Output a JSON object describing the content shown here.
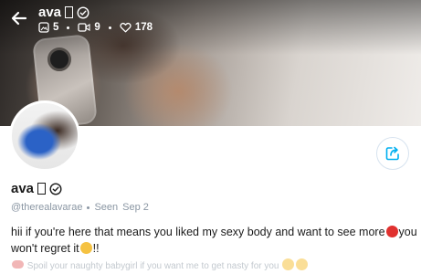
{
  "profile": {
    "display_name": "ava",
    "handle": "@therealavarae",
    "seen_label": "Seen",
    "seen_date": "Sep 2"
  },
  "stats": {
    "photos": "5",
    "videos": "9",
    "likes": "178"
  },
  "bio": {
    "line_start": "hii if you're here that means you liked my sexy body and want to see more",
    "line_middle": "you won't regret it",
    "line_end": "!!",
    "faded_line": "Spoil your naughty babygirl if you want me to get nasty for you"
  },
  "icons": {
    "back": "back-arrow-icon",
    "verified": "verified-check-icon",
    "photo": "photo-icon",
    "video": "video-icon",
    "like": "heart-icon",
    "share": "share-icon"
  },
  "colors": {
    "accent": "#00aff0",
    "muted_text": "#8a96a3",
    "faded_text": "#c3c9cf"
  }
}
